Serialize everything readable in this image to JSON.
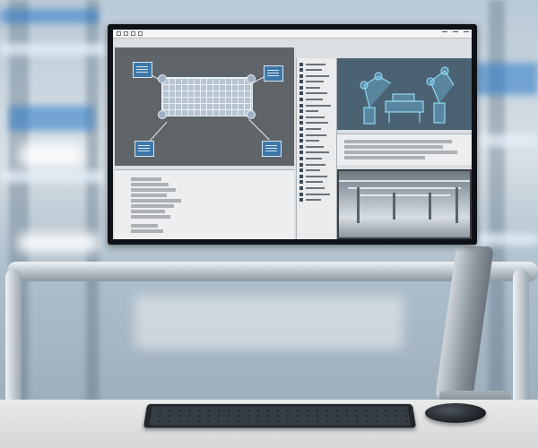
{
  "scene": {
    "subject": "monitor-on-desk",
    "colors": {
      "accent_blue": "#3e78a8",
      "monitor_bezel": "#0e1216",
      "desk": "#e9eaea"
    }
  },
  "screen": {
    "toolbar_icons": [
      "select-icon",
      "move-icon",
      "grid-icon",
      "zoom-icon"
    ],
    "panes": [
      "layout-diagram",
      "log-output",
      "object-tree",
      "robot-3d-view",
      "description-text",
      "factory-camera"
    ]
  }
}
